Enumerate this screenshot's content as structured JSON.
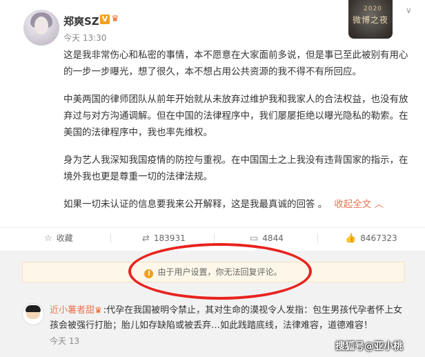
{
  "post": {
    "username": "郑爽SZ",
    "v_badge": "V",
    "member_icon": "crown-icon",
    "time": "今天 13:30",
    "top_badge_small": "2020",
    "top_badge_text": "微博之夜",
    "paragraphs": [
      "这是我非常伤心和私密的事情，本不愿意在大家面前多说，但是事已至此被别有用心的一步一步曝光，想了很久，本不想占用公共资源的我不得不有所回应。",
      "中美两国的律师团队从前年开始就从未放弃过维护我和我家人的合法权益，也没有放弃过与对方沟通调解。但在中国的法律程序中，我们屡屡拒绝以曝光隐私的勒索。在美国的法律程序中，我也率先维权。",
      "身为艺人我深知我国疫情的防控与重视。在中国国土之上我没有违背国家的指示，在境外我也更是尊重一切的法律法规。",
      "如果一切未认证的信息要我来公开解释，这是我最真诚的回答 。"
    ],
    "collapse_label": "收起全文 ︿"
  },
  "actions": {
    "favorite": "收藏",
    "repost": "183931",
    "comment": "4844",
    "like": "8467323"
  },
  "comments": {
    "notice": "由于用户设置，你无法回复评论。",
    "items": [
      {
        "user": "近小薯者甜",
        "text": ":代孕在我国被明令禁止，其对生命的漠视令人发指：包生男孩代孕者怀上女孩会被强行打胎；胎儿如存缺陷或被丢弃…如此践踏底线，法律难容，道德难容！",
        "time": "今天 13"
      }
    ]
  },
  "watermark": "搜狐号@亚小桃",
  "colors": {
    "accent": "#eb7350",
    "highlight_circle": "#e8231e",
    "notice_bg": "#fdf7ea"
  }
}
